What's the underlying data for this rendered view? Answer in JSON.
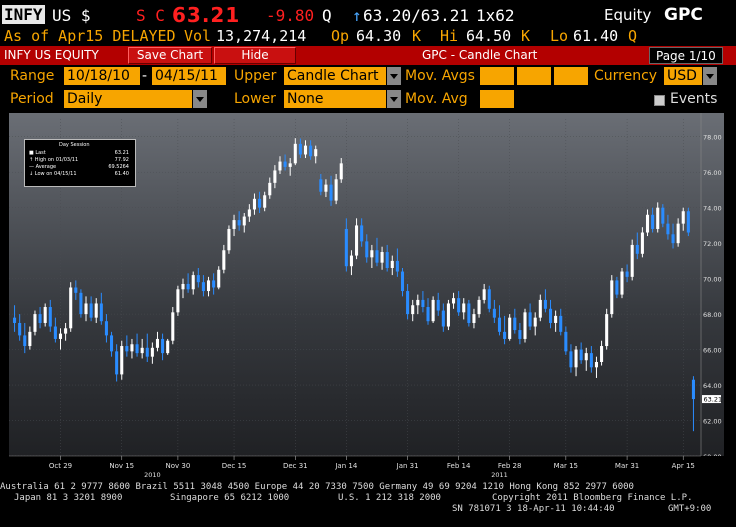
{
  "header": {
    "ticker": "INFY",
    "market": "US $",
    "flag": "S C",
    "last": "63.21",
    "change": "-9.80",
    "q1": "Q",
    "bid_ask_arrow": "↑",
    "bid_ask": "63.20/63.21",
    "size": "1x62",
    "brand_equity": "Equity",
    "brand_gpc": "GPC"
  },
  "subheader": {
    "as_of": "As of Apr15 DELAYED",
    "vol_label": "Vol",
    "vol": "13,274,214",
    "op_label": "Op",
    "op": "64.30",
    "op_k": "K",
    "hi_label": "Hi",
    "hi": "64.50",
    "hi_k": "K",
    "lo_label": "Lo",
    "lo": "61.40",
    "lo_q": "Q"
  },
  "toolbar": {
    "security": "INFY US EQUITY",
    "save_chart": "Save Chart",
    "hide": "Hide",
    "title": "GPC - Candle Chart",
    "page": "Page 1/10"
  },
  "controls": {
    "range_label": "Range",
    "range_start": "10/18/10",
    "range_sep": "-",
    "range_end": "04/15/11",
    "upper_label": "Upper",
    "upper_value": "Candle Chart",
    "mov_avgs_label": "Mov. Avgs",
    "currency_label": "Currency",
    "currency_value": "USD",
    "period_label": "Period",
    "period_value": "Daily",
    "lower_label": "Lower",
    "lower_value": "None",
    "mov_avg_label": "Mov. Avg",
    "events_label": "Events"
  },
  "legend": {
    "title": "Day Session",
    "rows": [
      {
        "label": "Last",
        "value": "63.21"
      },
      {
        "label": "High on 01/03/11",
        "value": "77.92"
      },
      {
        "label": "Average",
        "value": "69.5264"
      },
      {
        "label": "Low on 04/15/11",
        "value": "61.40"
      }
    ]
  },
  "colors": {
    "up": "#ffffff",
    "down": "#2a8cff",
    "accent": "#f7a500",
    "bar": "#b30000"
  },
  "chart_data": {
    "type": "candlestick",
    "ylim": [
      60,
      79
    ],
    "yticks": [
      "60.00",
      "62.00",
      "64.00",
      "66.00",
      "68.00",
      "70.00",
      "72.00",
      "74.00",
      "76.00",
      "78.00"
    ],
    "x_labels": [
      "Oct 29",
      "Nov 15",
      "Nov 30",
      "Dec 15",
      "Dec 31",
      "Jan 14",
      "Jan 31",
      "Feb 14",
      "Feb 28",
      "Mar 15",
      "Mar 31",
      "Apr 15"
    ],
    "x_label_index": [
      9,
      21,
      32,
      43,
      55,
      65,
      77,
      87,
      97,
      108,
      120,
      131
    ],
    "year_labels": [
      {
        "label": "2010",
        "index": 27
      },
      {
        "label": "2011",
        "index": 95
      }
    ],
    "last_label": "63.21",
    "candles": [
      [
        67.8,
        68.5,
        67.0,
        67.5
      ],
      [
        67.5,
        68.0,
        66.5,
        66.8
      ],
      [
        66.8,
        67.5,
        65.8,
        66.2
      ],
      [
        66.2,
        67.3,
        66.0,
        67.0
      ],
      [
        67.0,
        68.2,
        66.8,
        68.0
      ],
      [
        68.0,
        68.4,
        67.2,
        67.5
      ],
      [
        67.5,
        68.6,
        67.3,
        68.4
      ],
      [
        68.4,
        68.8,
        67.0,
        67.3
      ],
      [
        67.3,
        67.8,
        66.4,
        66.6
      ],
      [
        66.6,
        67.2,
        66.0,
        66.9
      ],
      [
        66.9,
        67.5,
        66.5,
        67.2
      ],
      [
        67.2,
        69.8,
        67.0,
        69.5
      ],
      [
        69.5,
        69.9,
        68.8,
        69.2
      ],
      [
        69.2,
        69.4,
        67.8,
        68.0
      ],
      [
        68.0,
        69.0,
        67.6,
        68.6
      ],
      [
        68.6,
        69.0,
        67.6,
        67.8
      ],
      [
        67.8,
        68.9,
        67.5,
        68.6
      ],
      [
        68.6,
        69.2,
        67.4,
        67.6
      ],
      [
        67.6,
        68.0,
        66.4,
        66.8
      ],
      [
        66.8,
        67.0,
        65.6,
        65.9
      ],
      [
        65.9,
        66.3,
        64.2,
        64.6
      ],
      [
        64.6,
        66.5,
        64.3,
        66.2
      ],
      [
        66.2,
        66.8,
        65.6,
        65.9
      ],
      [
        65.9,
        66.6,
        65.5,
        66.3
      ],
      [
        66.3,
        66.9,
        65.6,
        65.8
      ],
      [
        65.8,
        66.6,
        65.5,
        66.1
      ],
      [
        66.1,
        66.9,
        65.3,
        65.6
      ],
      [
        65.6,
        66.4,
        65.2,
        66.1
      ],
      [
        66.1,
        67.0,
        65.9,
        66.6
      ],
      [
        66.6,
        66.9,
        65.4,
        65.8
      ],
      [
        65.8,
        66.6,
        65.7,
        66.5
      ],
      [
        66.5,
        68.4,
        66.3,
        68.1
      ],
      [
        68.1,
        69.6,
        67.9,
        69.4
      ],
      [
        69.4,
        70.0,
        68.9,
        69.7
      ],
      [
        69.7,
        70.3,
        69.2,
        69.4
      ],
      [
        69.4,
        70.4,
        69.1,
        70.2
      ],
      [
        70.2,
        70.6,
        69.5,
        69.8
      ],
      [
        69.8,
        70.2,
        69.0,
        69.3
      ],
      [
        69.3,
        70.1,
        69.0,
        69.9
      ],
      [
        69.9,
        70.3,
        69.1,
        69.5
      ],
      [
        69.5,
        70.7,
        69.4,
        70.5
      ],
      [
        70.5,
        71.9,
        70.3,
        71.6
      ],
      [
        71.6,
        73.0,
        71.4,
        72.8
      ],
      [
        72.8,
        73.6,
        72.4,
        73.3
      ],
      [
        73.3,
        73.8,
        72.7,
        73.0
      ],
      [
        73.0,
        73.7,
        72.6,
        73.5
      ],
      [
        73.5,
        74.2,
        73.2,
        73.9
      ],
      [
        73.9,
        74.8,
        73.6,
        74.5
      ],
      [
        74.5,
        74.9,
        73.7,
        74.0
      ],
      [
        74.0,
        74.9,
        73.8,
        74.7
      ],
      [
        74.7,
        75.7,
        74.5,
        75.4
      ],
      [
        75.4,
        76.4,
        75.1,
        76.1
      ],
      [
        76.1,
        76.9,
        75.9,
        76.6
      ],
      [
        76.6,
        77.0,
        76.1,
        76.3
      ],
      [
        76.3,
        76.8,
        75.8,
        76.5
      ],
      [
        76.5,
        77.92,
        76.4,
        77.6
      ],
      [
        77.6,
        77.9,
        76.8,
        77.0
      ],
      [
        77.0,
        77.8,
        76.8,
        77.5
      ],
      [
        77.5,
        77.8,
        76.7,
        76.9
      ],
      [
        76.9,
        77.5,
        76.5,
        77.3
      ],
      [
        75.6,
        75.9,
        74.7,
        74.9
      ],
      [
        74.9,
        75.6,
        74.6,
        75.3
      ],
      [
        75.3,
        75.8,
        74.1,
        74.4
      ],
      [
        74.4,
        75.9,
        74.2,
        75.6
      ],
      [
        75.6,
        76.8,
        75.4,
        76.5
      ],
      [
        72.8,
        73.4,
        70.4,
        70.7
      ],
      [
        70.7,
        71.6,
        70.2,
        71.3
      ],
      [
        71.3,
        73.4,
        71.1,
        73.0
      ],
      [
        73.0,
        73.4,
        71.8,
        72.1
      ],
      [
        72.1,
        72.5,
        70.9,
        71.2
      ],
      [
        71.2,
        71.9,
        70.6,
        71.6
      ],
      [
        71.6,
        72.3,
        70.7,
        70.9
      ],
      [
        70.9,
        71.8,
        70.5,
        71.5
      ],
      [
        71.5,
        71.9,
        70.4,
        70.6
      ],
      [
        70.6,
        71.3,
        70.2,
        71.0
      ],
      [
        71.0,
        71.7,
        70.1,
        70.4
      ],
      [
        70.4,
        70.6,
        69.0,
        69.3
      ],
      [
        69.3,
        69.7,
        67.7,
        68.0
      ],
      [
        68.0,
        68.8,
        67.6,
        68.5
      ],
      [
        68.5,
        69.1,
        68.0,
        68.8
      ],
      [
        68.8,
        69.3,
        68.1,
        68.4
      ],
      [
        68.4,
        68.9,
        67.4,
        67.6
      ],
      [
        67.6,
        69.0,
        67.5,
        68.8
      ],
      [
        68.8,
        69.2,
        67.9,
        68.2
      ],
      [
        68.2,
        68.6,
        67.0,
        67.3
      ],
      [
        67.3,
        68.8,
        67.1,
        68.6
      ],
      [
        68.6,
        69.2,
        68.3,
        68.9
      ],
      [
        68.9,
        69.3,
        67.9,
        68.1
      ],
      [
        68.1,
        68.9,
        67.7,
        68.6
      ],
      [
        68.6,
        68.8,
        67.3,
        67.5
      ],
      [
        67.5,
        68.3,
        67.2,
        68.0
      ],
      [
        68.0,
        69.0,
        67.8,
        68.8
      ],
      [
        68.8,
        69.7,
        68.6,
        69.4
      ],
      [
        69.4,
        69.6,
        68.1,
        68.3
      ],
      [
        68.3,
        68.8,
        67.5,
        67.8
      ],
      [
        67.8,
        68.5,
        66.8,
        67.0
      ],
      [
        67.0,
        67.9,
        66.3,
        66.6
      ],
      [
        66.6,
        68.0,
        66.5,
        67.8
      ],
      [
        67.8,
        68.3,
        66.9,
        67.1
      ],
      [
        67.1,
        67.5,
        66.3,
        66.6
      ],
      [
        66.6,
        68.3,
        66.4,
        68.1
      ],
      [
        68.1,
        68.6,
        67.1,
        67.3
      ],
      [
        67.3,
        68.1,
        66.8,
        67.8
      ],
      [
        67.8,
        69.1,
        67.6,
        68.8
      ],
      [
        68.8,
        69.4,
        68.1,
        68.3
      ],
      [
        68.3,
        68.8,
        67.2,
        67.5
      ],
      [
        67.5,
        68.2,
        67.0,
        67.9
      ],
      [
        67.9,
        68.3,
        66.8,
        67.0
      ],
      [
        67.0,
        67.3,
        65.7,
        65.9
      ],
      [
        65.9,
        66.3,
        64.7,
        65.0
      ],
      [
        65.0,
        66.2,
        64.5,
        66.0
      ],
      [
        66.0,
        66.4,
        65.2,
        65.4
      ],
      [
        65.4,
        66.1,
        64.8,
        65.8
      ],
      [
        65.8,
        66.2,
        64.7,
        65.0
      ],
      [
        65.0,
        65.6,
        64.4,
        65.3
      ],
      [
        65.3,
        66.5,
        65.1,
        66.2
      ],
      [
        66.2,
        68.3,
        66.0,
        68.0
      ],
      [
        68.0,
        70.2,
        67.8,
        69.9
      ],
      [
        69.9,
        70.1,
        68.9,
        69.1
      ],
      [
        69.1,
        70.6,
        68.9,
        70.4
      ],
      [
        70.4,
        70.8,
        69.8,
        70.1
      ],
      [
        70.1,
        72.2,
        69.9,
        71.9
      ],
      [
        71.9,
        72.6,
        71.1,
        71.4
      ],
      [
        71.4,
        72.9,
        71.2,
        72.6
      ],
      [
        72.6,
        73.9,
        72.4,
        73.6
      ],
      [
        73.6,
        74.0,
        72.6,
        72.8
      ],
      [
        72.8,
        74.3,
        72.6,
        74.0
      ],
      [
        74.0,
        74.2,
        72.9,
        73.1
      ],
      [
        73.1,
        73.6,
        72.2,
        72.5
      ],
      [
        72.5,
        73.1,
        71.7,
        72.0
      ],
      [
        72.0,
        73.4,
        71.8,
        73.1
      ],
      [
        73.1,
        74.0,
        72.7,
        73.8
      ],
      [
        73.8,
        74.0,
        72.4,
        72.6
      ],
      [
        64.3,
        64.5,
        61.4,
        63.21
      ]
    ]
  },
  "footer": {
    "line1": "Australia 61 2 9777 8600 Brazil 5511 3048 4500 Europe 44 20 7330 7500 Germany 49 69 9204 1210 Hong Kong 852 2977 6000",
    "line2a": "Japan 81 3 3201 8900",
    "line2b": "Singapore 65 6212 1000",
    "line2c": "U.S. 1 212 318 2000",
    "line2d": "Copyright 2011 Bloomberg Finance L.P.",
    "line3a": "SN 781071 3 18-Apr-11 10:44:40",
    "line3b": "GMT+9:00"
  }
}
